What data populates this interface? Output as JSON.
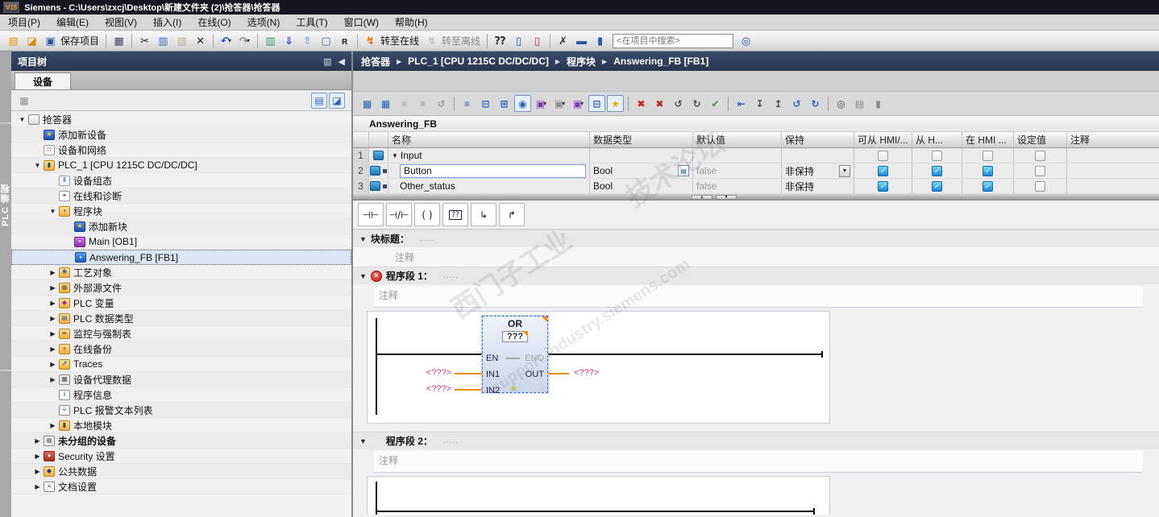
{
  "window": {
    "logo": "V15",
    "title": "Siemens  -  C:\\Users\\zxcj\\Desktop\\新建文件夹 (2)\\抢答器\\抢答器"
  },
  "menubar": {
    "items": [
      "项目(P)",
      "编辑(E)",
      "视图(V)",
      "插入(I)",
      "在线(O)",
      "选项(N)",
      "工具(T)",
      "窗口(W)",
      "帮助(H)"
    ]
  },
  "main_toolbar": {
    "items": [
      {
        "t": "icon",
        "name": "new-project-icon",
        "g": "▤",
        "c": "#e89800"
      },
      {
        "t": "icon",
        "name": "open-project-icon",
        "g": "◪",
        "c": "#d88a00"
      },
      {
        "t": "icon",
        "name": "save-project-icon",
        "g": "▣",
        "c": "#2858a8"
      },
      {
        "t": "label",
        "name": "save-project-label",
        "text": "保存项目"
      },
      {
        "t": "sep"
      },
      {
        "t": "icon",
        "name": "print-icon",
        "g": "▦",
        "c": "#44446a"
      },
      {
        "t": "sep"
      },
      {
        "t": "icon",
        "name": "cut-icon",
        "g": "✂",
        "c": "#222222"
      },
      {
        "t": "icon",
        "name": "copy-icon",
        "g": "▥",
        "c": "#3a6ab0"
      },
      {
        "t": "icon",
        "name": "paste-icon",
        "g": "▧",
        "c": "#8a6a30",
        "dim": true
      },
      {
        "t": "icon",
        "name": "delete-icon",
        "g": "✕",
        "c": "#222222"
      },
      {
        "t": "sep"
      },
      {
        "t": "icon",
        "name": "undo-icon",
        "g": "↶",
        "c": "#2050c0",
        "dd": true
      },
      {
        "t": "icon",
        "name": "redo-icon",
        "g": "↷",
        "c": "#8a8a8a",
        "dd": true
      },
      {
        "t": "sep"
      },
      {
        "t": "icon",
        "name": "compile-icon",
        "g": "▥",
        "c": "#3a9a6a"
      },
      {
        "t": "icon",
        "name": "download-icon",
        "g": "⇓",
        "c": "#2858c8"
      },
      {
        "t": "icon",
        "name": "upload-icon",
        "g": "⇑",
        "c": "#2858c8",
        "dim": true
      },
      {
        "t": "icon",
        "name": "start-cpu-icon",
        "g": "▢",
        "c": "#4a6a9a"
      },
      {
        "t": "icon",
        "name": "stop-cpu-icon",
        "g": "ʀ",
        "c": "#333333"
      },
      {
        "t": "sep"
      },
      {
        "t": "icon",
        "name": "go-online-icon",
        "g": "↯",
        "c": "#e87000"
      },
      {
        "t": "label",
        "name": "go-online-label",
        "text": "转至在线"
      },
      {
        "t": "icon",
        "name": "go-offline-icon",
        "g": "↯",
        "c": "#9a9a9a",
        "dim": true
      },
      {
        "t": "label",
        "name": "go-offline-label",
        "text": "转至离线",
        "dim": true
      },
      {
        "t": "sep"
      },
      {
        "t": "icon",
        "name": "accessible-devices-icon",
        "g": "⁇",
        "c": "#333333"
      },
      {
        "t": "icon",
        "name": "start-simulation-icon",
        "g": "▯",
        "c": "#2858a8"
      },
      {
        "t": "icon",
        "name": "stop-simulation-icon",
        "g": "▯",
        "c": "#c83030"
      },
      {
        "t": "sep"
      },
      {
        "t": "icon",
        "name": "cross-references-icon",
        "g": "✗",
        "c": "#333333"
      },
      {
        "t": "icon",
        "name": "split-horizontal-icon",
        "g": "▬",
        "c": "#2858a8"
      },
      {
        "t": "icon",
        "name": "split-vertical-icon",
        "g": "▮",
        "c": "#2858a8"
      },
      {
        "t": "search",
        "name": "project-search-input",
        "placeholder": "<在项目中搜索>"
      },
      {
        "t": "icon",
        "name": "search-project-icon",
        "g": "◎",
        "c": "#2858a8"
      }
    ]
  },
  "side_tab": {
    "label": "PLC 编程"
  },
  "project_tree": {
    "title": "项目树",
    "tab": "设备",
    "header_icons": [
      {
        "name": "columns-icon",
        "g": "▥"
      },
      {
        "name": "collapse-panel-icon",
        "g": "◀"
      }
    ],
    "toolbar_icons": [
      {
        "name": "device-overview-icon",
        "g": "▦",
        "dim": true,
        "right": false
      },
      {
        "name": "details-view-icon",
        "g": "▤",
        "active": true,
        "right": true
      },
      {
        "name": "open-new-editor-icon",
        "g": "◪",
        "active": true,
        "right": true
      }
    ],
    "items": [
      {
        "label": "抢答器",
        "level": 0,
        "exp": "down",
        "icon": "project"
      },
      {
        "label": "添加新设备",
        "level": 1,
        "icon": "add-device"
      },
      {
        "label": "设备和网络",
        "level": 1,
        "icon": "devices-networks"
      },
      {
        "label": "PLC_1 [CPU 1215C DC/DC/DC]",
        "level": 1,
        "exp": "down",
        "icon": "plc"
      },
      {
        "label": "设备组态",
        "level": 2,
        "icon": "device-config"
      },
      {
        "label": "在线和诊断",
        "level": 2,
        "icon": "online-diag"
      },
      {
        "label": "程序块",
        "level": 2,
        "exp": "down",
        "icon": "program-blocks"
      },
      {
        "label": "添加新块",
        "level": 3,
        "icon": "add-block"
      },
      {
        "label": "Main [OB1]",
        "level": 3,
        "icon": "ob-block"
      },
      {
        "label": "Answering_FB [FB1]",
        "level": 3,
        "icon": "fb-block",
        "selected": true
      },
      {
        "label": "工艺对象",
        "level": 2,
        "exp": "right",
        "icon": "tech-objects"
      },
      {
        "label": "外部源文件",
        "level": 2,
        "exp": "right",
        "icon": "external-sources"
      },
      {
        "label": "PLC 变量",
        "level": 2,
        "exp": "right",
        "icon": "plc-tags"
      },
      {
        "label": "PLC 数据类型",
        "level": 2,
        "exp": "right",
        "icon": "plc-datatypes"
      },
      {
        "label": "监控与强制表",
        "level": 2,
        "exp": "right",
        "icon": "watch-tables"
      },
      {
        "label": "在线备份",
        "level": 2,
        "exp": "right",
        "icon": "online-backups"
      },
      {
        "label": "Traces",
        "level": 2,
        "exp": "right",
        "icon": "traces"
      },
      {
        "label": "设备代理数据",
        "level": 2,
        "exp": "right",
        "icon": "proxy-data"
      },
      {
        "label": "程序信息",
        "level": 2,
        "icon": "program-info"
      },
      {
        "label": "PLC 报警文本列表",
        "level": 2,
        "icon": "alarm-texts"
      },
      {
        "label": "本地模块",
        "level": 2,
        "exp": "right",
        "icon": "local-modules"
      },
      {
        "label": "未分组的设备",
        "level": 1,
        "exp": "right",
        "icon": "ungrouped",
        "bold": true
      },
      {
        "label": "Security 设置",
        "level": 1,
        "exp": "right",
        "icon": "security"
      },
      {
        "label": "公共数据",
        "level": 1,
        "exp": "right",
        "icon": "common-data"
      },
      {
        "label": "文档设置",
        "level": 1,
        "exp": "right",
        "icon": "doc-settings"
      }
    ]
  },
  "breadcrumb": {
    "items": [
      "抢答器",
      "PLC_1 [CPU 1215C DC/DC/DC]",
      "程序块",
      "Answering_FB [FB1]"
    ]
  },
  "editor": {
    "block_name": "Answering_FB",
    "toolbar_icons": [
      {
        "name": "insert-network-icon",
        "g": "▦",
        "c": "#2b62b8"
      },
      {
        "name": "delete-network-icon",
        "g": "▦",
        "c": "#2b62b8"
      },
      {
        "name": "insert-row-icon",
        "g": "≡",
        "c": "#9a9a9a",
        "dim": true
      },
      {
        "name": "add-row-icon",
        "g": "≡",
        "c": "#9a9a9a",
        "dim": true
      },
      {
        "name": "reset-start-values-icon",
        "g": "↺",
        "c": "#9a9a9a",
        "dim": true
      },
      {
        "name": "sep"
      },
      {
        "name": "outline-icon",
        "g": "≡",
        "c": "#2b62b8"
      },
      {
        "name": "expand-networks-icon",
        "g": "⊟",
        "c": "#2b62b8"
      },
      {
        "name": "collapse-networks-icon",
        "g": "⊞",
        "c": "#2b62b8"
      },
      {
        "name": "comments-toggle-icon",
        "g": "◉",
        "c": "#2b62b8",
        "active": true
      },
      {
        "name": "absolute-operands-icon",
        "g": "▣",
        "c": "#7a3ab8",
        "dd": true
      },
      {
        "name": "operand-quality-icon",
        "g": "▣",
        "c": "#8a8a8a",
        "dd": true
      },
      {
        "name": "symbol-display-icon",
        "g": "▣",
        "c": "#7a3ab8",
        "dd": true
      },
      {
        "name": "network-display-icon",
        "g": "⊟",
        "c": "#2b62b8",
        "active": true
      },
      {
        "name": "favorites-toggle-icon",
        "g": "★",
        "c": "#e8b000",
        "active": true
      },
      {
        "name": "sep"
      },
      {
        "name": "clear-call-envelope-icon",
        "g": "✖",
        "c": "#c42020"
      },
      {
        "name": "delete-call-envelope-icon",
        "g": "✖",
        "c": "#c42020"
      },
      {
        "name": "update-block-calls-icon",
        "g": "↺",
        "c": "#4a4a4a"
      },
      {
        "name": "refresh-interface-icon",
        "g": "↻",
        "c": "#4a4a4a"
      },
      {
        "name": "consistency-check-icon",
        "g": "✔",
        "c": "#2a9a2a"
      },
      {
        "name": "sep"
      },
      {
        "name": "goto-previous-icon",
        "g": "⇤",
        "c": "#2b62b8"
      },
      {
        "name": "goto-definition-icon",
        "g": "↧",
        "c": "#4a4a4a"
      },
      {
        "name": "goto-usage-icon",
        "g": "↥",
        "c": "#4a4a4a"
      },
      {
        "name": "previous-error-icon",
        "g": "↺",
        "c": "#2b62b8"
      },
      {
        "name": "next-error-icon",
        "g": "↻",
        "c": "#2b62b8"
      },
      {
        "name": "sep"
      },
      {
        "name": "zoom-selection-icon",
        "g": "◎",
        "c": "#4a4a4a"
      },
      {
        "name": "snapshot-icon",
        "g": "▤",
        "c": "#8a8a8a"
      },
      {
        "name": "library-icon",
        "g": "▮",
        "c": "#8a8a8a"
      }
    ],
    "table": {
      "headers": [
        "名称",
        "数据类型",
        "默认值",
        "保持",
        "可从 HMI/...",
        "从 H...",
        "在 HMI ...",
        "设定值",
        "注释"
      ],
      "rows": [
        {
          "num": "1",
          "kind": "group",
          "name": "Input",
          "hmi": [
            false,
            false,
            false
          ],
          "setpoint": false
        },
        {
          "num": "2",
          "kind": "var",
          "name": "Button",
          "data_type": "Bool",
          "default_value": "false",
          "retain": "非保持",
          "hmi": [
            true,
            true,
            true
          ],
          "setpoint": false,
          "editing": true,
          "type_browse": true,
          "retain_dd": true
        },
        {
          "num": "3",
          "kind": "var",
          "name": "Other_status",
          "data_type": "Bool",
          "default_value": "false",
          "retain": "非保持",
          "hmi": [
            true,
            true,
            true
          ],
          "setpoint": false
        }
      ]
    },
    "favorites": [
      {
        "name": "normally-open-contact",
        "glyph": "⊣⊢"
      },
      {
        "name": "normally-closed-contact",
        "glyph": "⊣/⊢"
      },
      {
        "name": "coil",
        "glyph": "( )"
      },
      {
        "name": "empty-box",
        "glyph": "??",
        "boxed": true
      },
      {
        "name": "open-branch",
        "glyph": "↳"
      },
      {
        "name": "close-branch",
        "glyph": "↱"
      }
    ],
    "block_title": {
      "label": "块标题：",
      "dots": ".....",
      "comment": "注释"
    },
    "networks": [
      {
        "label": "程序段 1：",
        "dots": ".....",
        "comment": "注释",
        "error": true
      },
      {
        "label": "程序段 2：",
        "dots": ".....",
        "comment": "注释",
        "error": false
      }
    ],
    "ladder": {
      "block_title": "OR",
      "block_type": "???",
      "pin_en": "EN",
      "pin_eno": "ENO",
      "pin_in1": "IN1",
      "pin_in2": "IN2",
      "pin_out": "OUT",
      "operand_in1": "<???>",
      "operand_in2": "<???>",
      "operand_out": "<???>"
    }
  },
  "watermark": {
    "texts": [
      "西门子工业",
      "技术论坛",
      "support.industry.siemens.com"
    ]
  },
  "colors": {
    "header_blue": "#2e3c59",
    "wire_orange": "#f28a00",
    "operand_red": "#d43a6a",
    "checked_blue": "#1b86d4",
    "error_red": "#c41e1e"
  }
}
